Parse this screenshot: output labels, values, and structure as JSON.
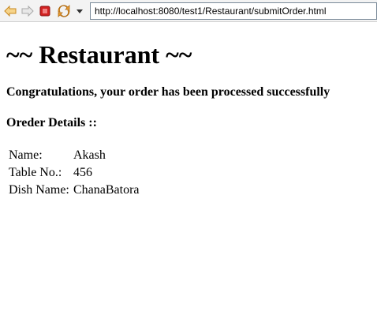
{
  "browser": {
    "url": "http://localhost:8080/test1/Restaurant/submitOrder.html",
    "icons": {
      "back": "arrow-left-icon",
      "forward": "arrow-right-icon",
      "stop": "stop-icon",
      "refresh": "refresh-icon",
      "menu": "dropdown-arrow-icon"
    },
    "colors": {
      "back": "#e0a030",
      "stop": "#d02020",
      "refresh": "#e08a20"
    }
  },
  "page": {
    "title": "~~ Restaurant ~~",
    "message": "Congratulations, your order has been processed successfully",
    "details_title": "Oreder Details ::",
    "details": [
      {
        "label": "Name:",
        "value": "Akash"
      },
      {
        "label": "Table No.:",
        "value": "456"
      },
      {
        "label": "Dish Name:",
        "value": "ChanaBatora"
      }
    ]
  }
}
